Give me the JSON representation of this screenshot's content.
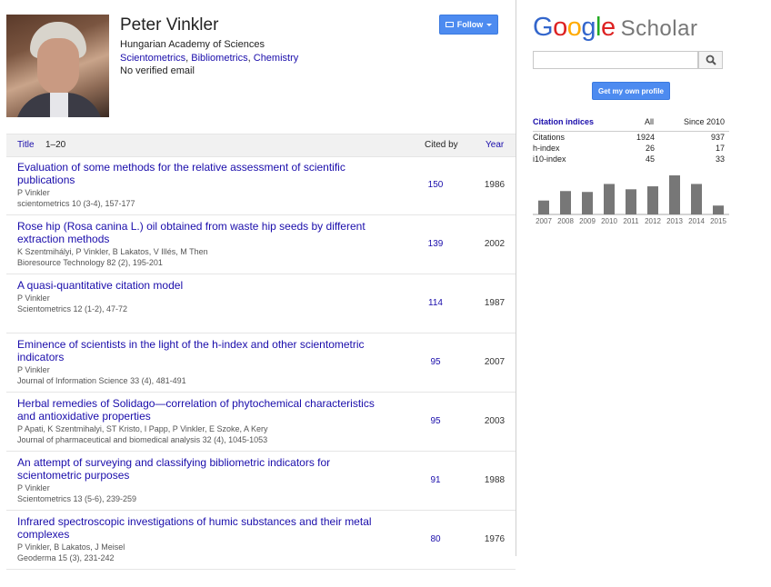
{
  "profile": {
    "name": "Peter Vinkler",
    "affiliation": "Hungarian Academy of Sciences",
    "interests": [
      "Scientometrics",
      "Bibliometrics",
      "Chemistry"
    ],
    "email_status": "No verified email",
    "follow_label": "Follow"
  },
  "table": {
    "title_header": "Title",
    "range": "1–20",
    "cited_header": "Cited by",
    "year_header": "Year",
    "rows": [
      {
        "title": "Evaluation of some methods for the relative assessment of scientific publications",
        "authors": "P Vinkler",
        "venue": "scientometrics 10 (3-4), 157-177",
        "cited": "150",
        "year": "1986"
      },
      {
        "title": "Rose hip (Rosa canina L.) oil obtained from waste hip seeds by different extraction methods",
        "authors": "K Szentmihályi, P Vinkler, B Lakatos, V Illés, M Then",
        "venue": "Bioresource Technology 82 (2), 195-201",
        "cited": "139",
        "year": "2002"
      },
      {
        "title": "A quasi-quantitative citation model",
        "authors": "P Vinkler",
        "venue": "Scientometrics 12 (1-2), 47-72",
        "cited": "114",
        "year": "1987"
      },
      {
        "title": "Eminence of scientists in the light of the h-index and other scientometric indicators",
        "authors": "P Vinkler",
        "venue": "Journal of Information Science 33 (4), 481-491",
        "cited": "95",
        "year": "2007"
      },
      {
        "title": "Herbal remedies of Solidago—correlation of phytochemical characteristics and antioxidative properties",
        "authors": "P Apati, K Szentmihalyi, ST Kristo, I Papp, P Vinkler, E Szoke, A Kery",
        "venue": "Journal of pharmaceutical and biomedical analysis 32 (4), 1045-1053",
        "cited": "95",
        "year": "2003"
      },
      {
        "title": "An attempt of surveying and classifying bibliometric indicators for scientometric purposes",
        "authors": "P Vinkler",
        "venue": "Scientometrics 13 (5-6), 239-259",
        "cited": "91",
        "year": "1988"
      },
      {
        "title": "Infrared spectroscopic investigations of humic substances and their metal complexes",
        "authors": "P Vinkler, B Lakatos, J Meisel",
        "venue": "Geoderma 15 (3), 231-242",
        "cited": "80",
        "year": "1976"
      }
    ]
  },
  "sidebar": {
    "logo_letters": [
      "G",
      "o",
      "o",
      "g",
      "l",
      "e"
    ],
    "logo_word": "Scholar",
    "search_value": "",
    "own_profile_label": "Get my own profile",
    "citation_header": "Citation indices",
    "col_all": "All",
    "col_since": "Since 2010",
    "indices": [
      {
        "label": "Citations",
        "all": "1924",
        "since": "937"
      },
      {
        "label": "h-index",
        "all": "26",
        "since": "17"
      },
      {
        "label": "i10-index",
        "all": "45",
        "since": "33"
      }
    ]
  },
  "chart_data": {
    "type": "bar",
    "categories": [
      "2007",
      "2008",
      "2009",
      "2010",
      "2011",
      "2012",
      "2013",
      "2014",
      "2015"
    ],
    "values": [
      47,
      79,
      76,
      103,
      85,
      95,
      132,
      103,
      30
    ],
    "bar_color": "#777777"
  }
}
